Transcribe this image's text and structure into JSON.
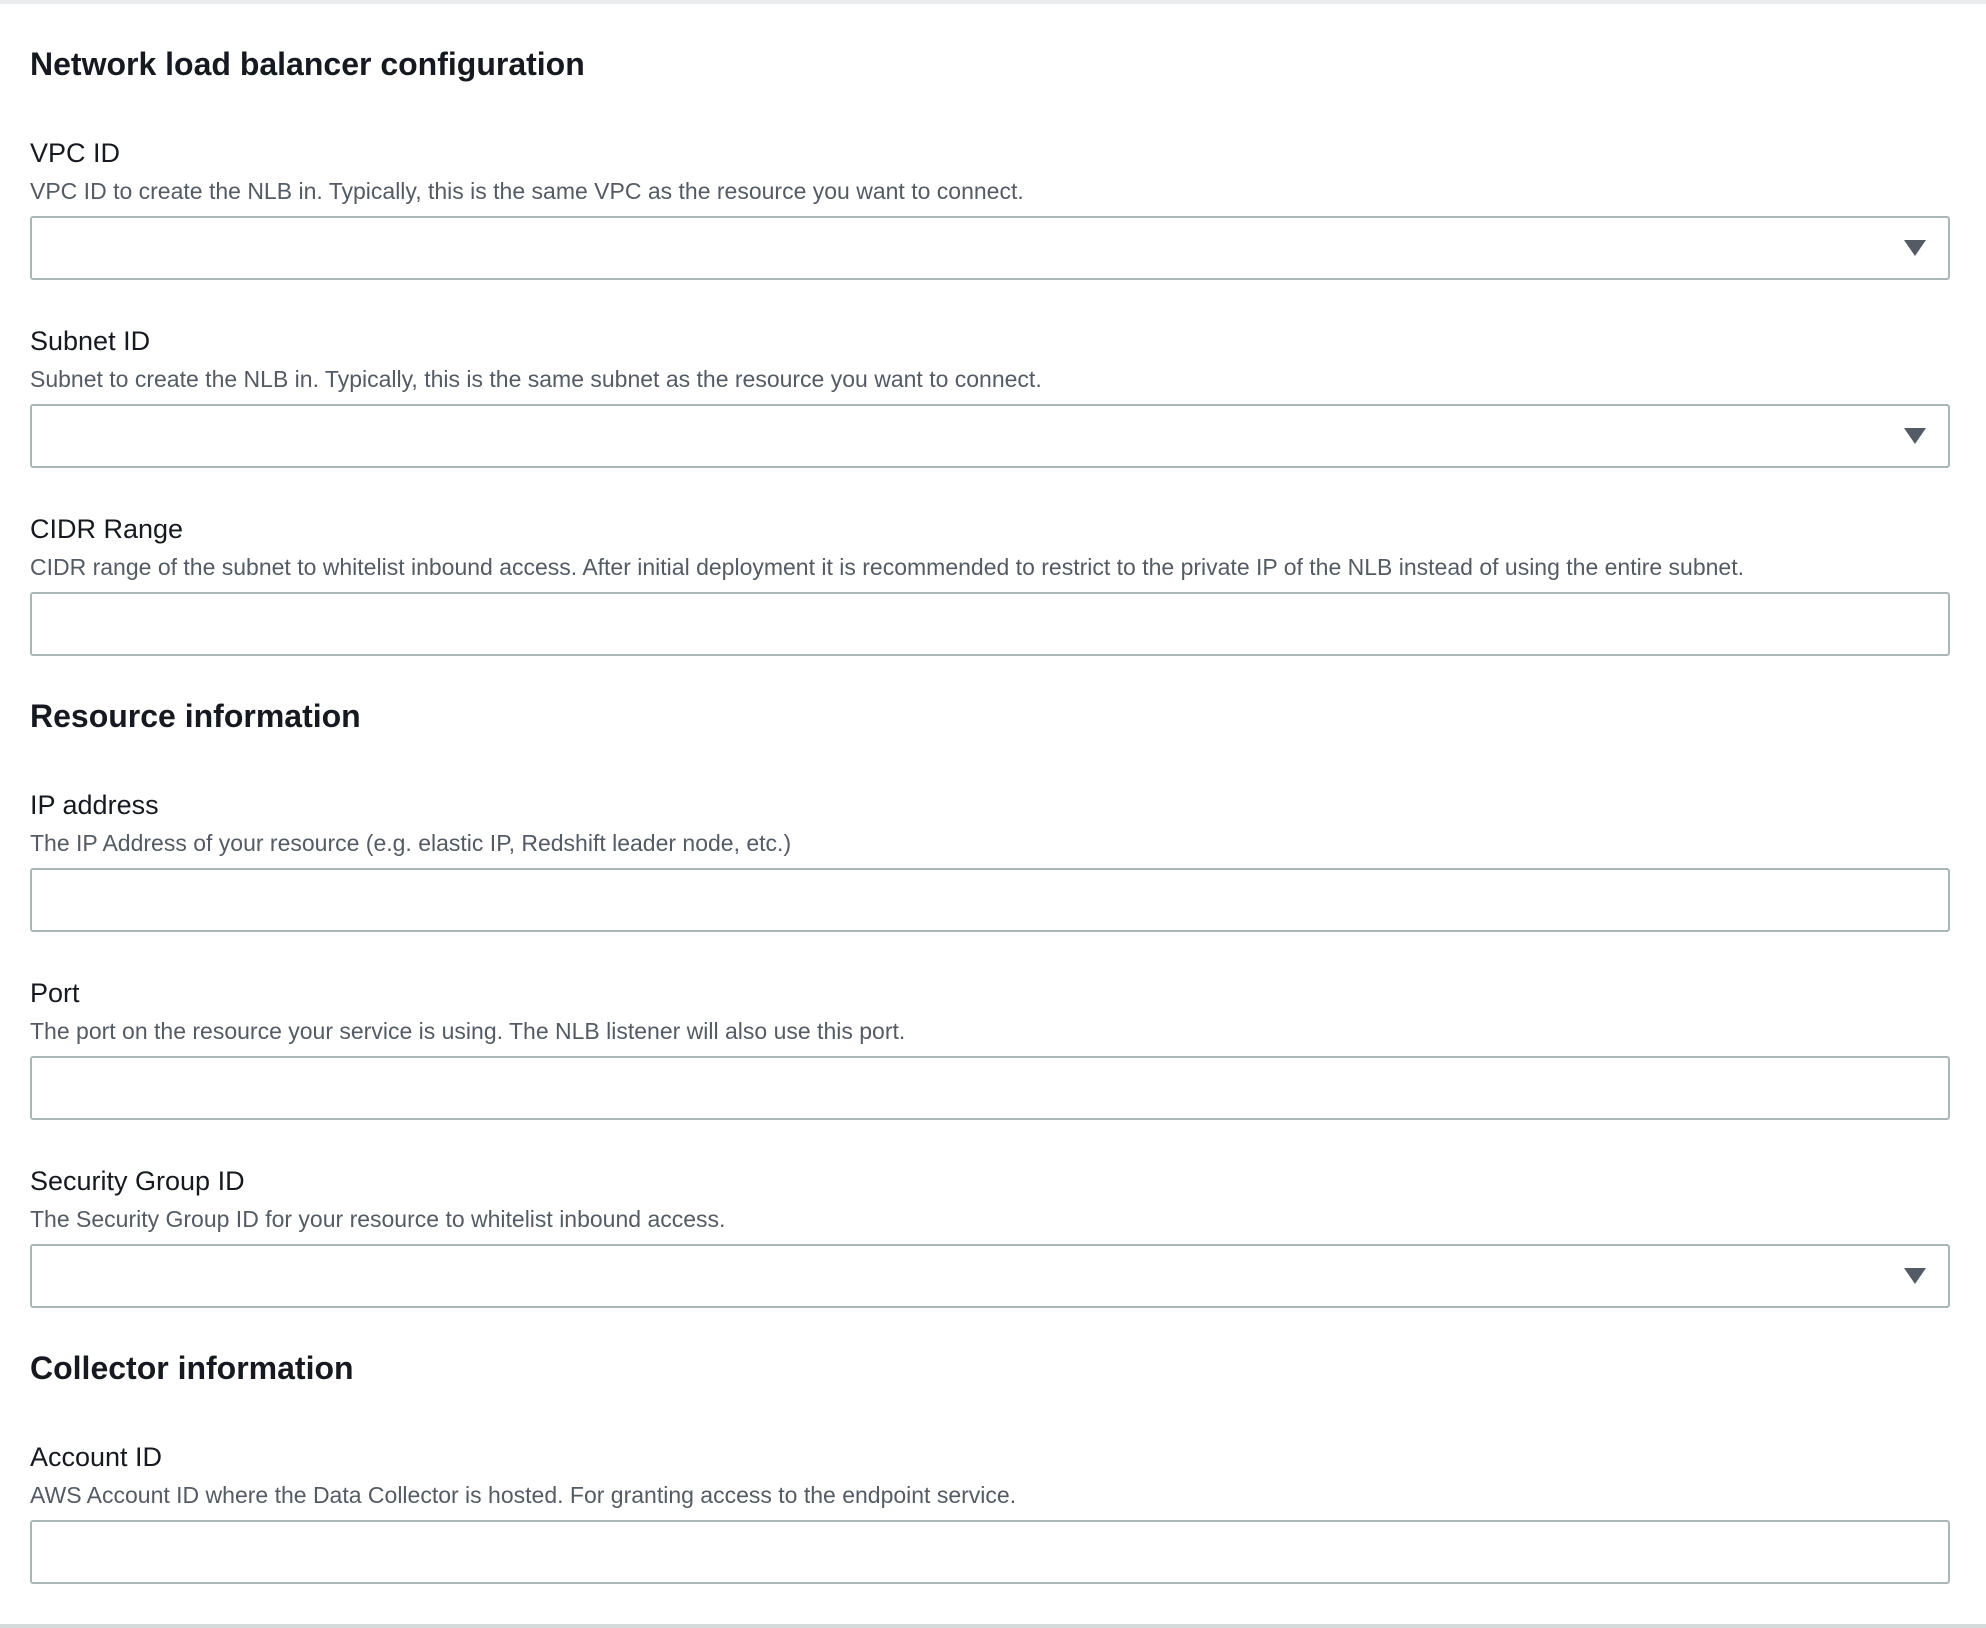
{
  "sections": {
    "nlb": {
      "heading": "Network load balancer configuration",
      "vpc": {
        "label": "VPC ID",
        "description": "VPC ID to create the NLB in. Typically, this is the same VPC as the resource you want to connect.",
        "value": "",
        "icon": "caret-down-icon"
      },
      "subnet": {
        "label": "Subnet ID",
        "description": "Subnet to create the NLB in. Typically, this is the same subnet as the resource you want to connect.",
        "value": "",
        "icon": "caret-down-icon"
      },
      "cidr": {
        "label": "CIDR Range",
        "description": "CIDR range of the subnet to whitelist inbound access. After initial deployment it is recommended to restrict to the private IP of the NLB instead of using the entire subnet.",
        "value": ""
      }
    },
    "resource": {
      "heading": "Resource information",
      "ip": {
        "label": "IP address",
        "description": "The IP Address of your resource (e.g. elastic IP, Redshift leader node, etc.)",
        "value": ""
      },
      "port": {
        "label": "Port",
        "description": "The port on the resource your service is using. The NLB listener will also use this port.",
        "value": ""
      },
      "security_group": {
        "label": "Security Group ID",
        "description": "The Security Group ID for your resource to whitelist inbound access.",
        "value": "",
        "icon": "caret-down-icon"
      }
    },
    "collector": {
      "heading": "Collector information",
      "account": {
        "label": "Account ID",
        "description": "AWS Account ID where the Data Collector is hosted. For granting access to the endpoint service.",
        "value": ""
      }
    }
  },
  "colors": {
    "text": "#16191f",
    "description": "#545b64",
    "border": "#aab7b8"
  }
}
